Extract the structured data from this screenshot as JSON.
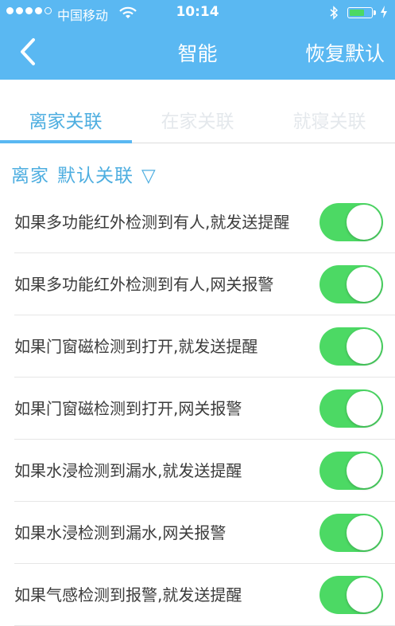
{
  "status_bar": {
    "carrier": "中国移动",
    "time": "10:14"
  },
  "nav": {
    "title": "智能",
    "right_action": "恢复默认"
  },
  "tabs": [
    {
      "label": "离家关联",
      "active": true
    },
    {
      "label": "在家关联",
      "active": false
    },
    {
      "label": "就寝关联",
      "active": false
    }
  ],
  "section": {
    "mode": "离家",
    "preset": "默认关联",
    "arrow": "▽"
  },
  "rules": [
    {
      "text": "如果多功能红外检测到有人,就发送提醒",
      "enabled": true
    },
    {
      "text": "如果多功能红外检测到有人,网关报警",
      "enabled": true
    },
    {
      "text": "如果门窗磁检测到打开,就发送提醒",
      "enabled": true
    },
    {
      "text": "如果门窗磁检测到打开,网关报警",
      "enabled": true
    },
    {
      "text": "如果水浸检测到漏水,就发送提醒",
      "enabled": true
    },
    {
      "text": "如果水浸检测到漏水,网关报警",
      "enabled": true
    },
    {
      "text": "如果气感检测到报警,就发送提醒",
      "enabled": true
    }
  ],
  "colors": {
    "header": "#5ab8f2",
    "accent_text": "#4eaee0",
    "switch_on": "#4cd964",
    "inactive_tab": "#e4e8ec"
  }
}
